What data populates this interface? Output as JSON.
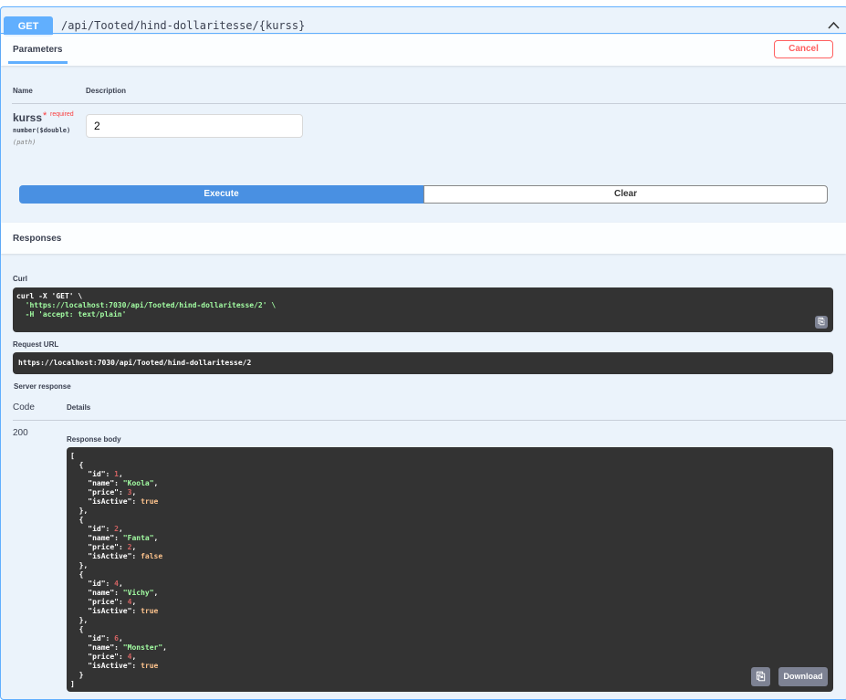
{
  "operation": {
    "method": "GET",
    "path": "/api/Tooted/hind-dollaritesse/{kurss}"
  },
  "parameters": {
    "tab_label": "Parameters",
    "cancel_label": "Cancel",
    "col_name": "Name",
    "col_description": "Description",
    "param": {
      "name": "kurss",
      "required_star": "*",
      "required_label": "required",
      "type": "number($double)",
      "location": "(path)",
      "value": "2"
    }
  },
  "actions": {
    "execute_label": "Execute",
    "clear_label": "Clear"
  },
  "responses": {
    "title": "Responses",
    "curl_label": "Curl",
    "curl_lines": [
      "curl -X 'GET' \\",
      "  'https://localhost:7030/api/Tooted/hind-dollaritesse/2' \\",
      "  -H 'accept: text/plain'"
    ],
    "request_url_label": "Request URL",
    "request_url": "https://localhost:7030/api/Tooted/hind-dollaritesse/2",
    "server_response_label": "Server response",
    "col_code": "Code",
    "col_details": "Details",
    "code": "200",
    "body_label": "Response body",
    "download_label": "Download",
    "body_items": [
      {
        "id": "1",
        "name": "Koola",
        "price": "3",
        "isActive": "true"
      },
      {
        "id": "2",
        "name": "Fanta",
        "price": "2",
        "isActive": "false"
      },
      {
        "id": "4",
        "name": "Vichy",
        "price": "4",
        "isActive": "true"
      },
      {
        "id": "6",
        "name": "Monster",
        "price": "4",
        "isActive": "true"
      }
    ]
  },
  "colors": {
    "get": "#61affe",
    "cancel": "#ff6060",
    "execute": "#4990e2",
    "code_bg": "#333333"
  }
}
